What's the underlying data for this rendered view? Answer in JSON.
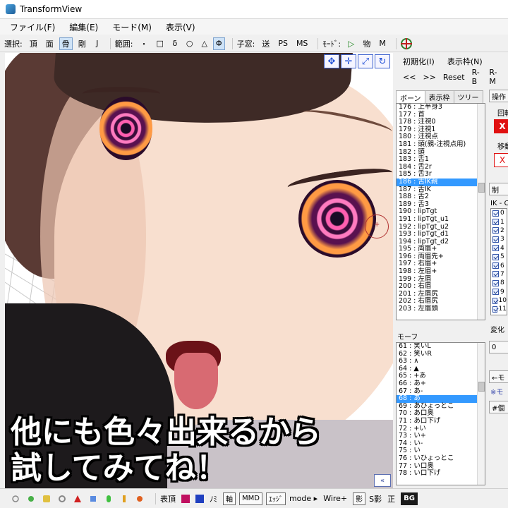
{
  "window": {
    "title": "TransformView"
  },
  "menu": [
    "ファイル(F)",
    "編集(E)",
    "モード(M)",
    "表示(V)"
  ],
  "toolbar": {
    "select_label": "選択:",
    "select_buttons": [
      "頂",
      "面",
      "骨",
      "剛",
      "J"
    ],
    "range_label": "範囲:",
    "range_buttons": [
      "・",
      "□",
      "δ",
      "○",
      "△",
      "Φ"
    ],
    "window_label": "子窓:",
    "window_buttons": [
      "送",
      "PS",
      "MS"
    ],
    "mode_label": "ﾓｰﾄﾞ:",
    "mode_buttons": [
      "▷",
      "物",
      "M"
    ]
  },
  "caption": {
    "line1": "他にも色々出来るから",
    "line2": "試してみてね！"
  },
  "panel": {
    "top_row1": [
      "初期化(I)",
      "表示枠(N)"
    ],
    "top_row2": [
      "<<",
      ">>",
      "Reset",
      "R-B",
      "R-M"
    ],
    "tabs": [
      "ボーン",
      "表示枠",
      "ツリー"
    ],
    "bones": [
      "176 : 上半身3",
      "177 : 首",
      "178 : 注視0",
      "179 : 注視1",
      "180 : 注視点",
      "181 : 頭(親-注視点用)",
      "182 : 頭",
      "183 : 舌1",
      "184 : 舌2r",
      "185 : 舌3r",
      "186 : 舌IK親",
      "187 : 舌IK",
      "188 : 舌2",
      "189 : 舌3",
      "190 : lipTgt",
      "191 : lipTgt_u1",
      "192 : lipTgt_u2",
      "193 : lipTgt_d1",
      "194 : lipTgt_d2",
      "195 : 両眉+",
      "196 : 両眉先+",
      "197 : 右眉+",
      "198 : 左眉+",
      "199 : 左眉",
      "200 : 右眉",
      "201 : 左眉尻",
      "202 : 右眉尻",
      "203 : 左眉頭"
    ],
    "bone_selected": "186 : 舌IK親",
    "morph_label": "モーフ",
    "morphs": [
      "61 : 笑いL",
      "62 : 笑いR",
      "63 : ∧",
      "64 : ▲",
      "65 : +あ",
      "66 : あ+",
      "67 : あ-",
      "68 : あ",
      "69 : あひょっとこ",
      "70 : あ口奥",
      "71 : あ口下げ",
      "72 : +い",
      "73 : い+",
      "74 : い-",
      "75 : い",
      "76 : いひょっとこ",
      "77 : い口奥",
      "78 : い口下げ"
    ],
    "morph_selected": "68 : あ",
    "side": {
      "op": "操作",
      "rot": "回転",
      "move": "移動",
      "x_mark": "X",
      "ctrl": "制",
      "ik": "IK - C",
      "ik_rows": [
        "0",
        "1",
        "2",
        "3",
        "4",
        "5",
        "6",
        "7",
        "8",
        "9",
        "10",
        "11"
      ],
      "change": "変化",
      "zero": "0",
      "arrow_btn": "←モ",
      "note": "※モ",
      "hash_btn": "#個"
    }
  },
  "statusbar": {
    "show_top": "表頂",
    "mi": "ﾉﾐ",
    "axis": "軸",
    "mmd": "MMD",
    "edge": "ｴｯｼﾞ",
    "mode": "mode ▸",
    "wire": "Wire+",
    "shadow": "影",
    "sshadow": "S影",
    "sei": "正",
    "bg": "BG"
  },
  "colors": {
    "accent_blue": "#3399ff",
    "red": "#e01010",
    "caption_fill": "#ffffff"
  },
  "icons": [
    "app-icon",
    "play-icon",
    "physics-icon",
    "target-icon",
    "move-gizmo-icon",
    "rotate-gizmo-icon",
    "collapse-icon"
  ]
}
